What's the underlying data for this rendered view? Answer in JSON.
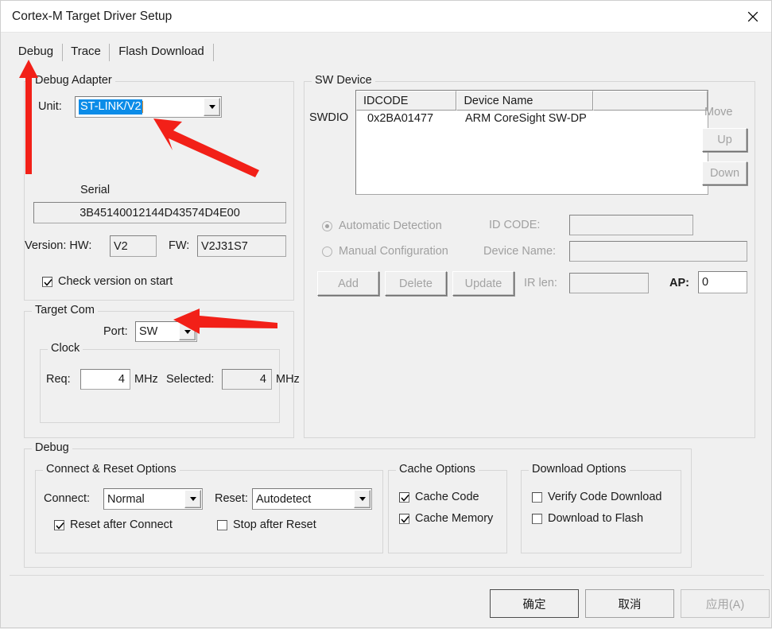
{
  "window": {
    "title": "Cortex-M Target Driver Setup",
    "close_icon": "close-x-icon"
  },
  "tabs": [
    {
      "label": "Debug",
      "selected": true
    },
    {
      "label": "Trace",
      "selected": false
    },
    {
      "label": "Flash Download",
      "selected": false
    }
  ],
  "debug_adapter": {
    "legend": "Debug Adapter",
    "unit_label": "Unit:",
    "unit_value": "ST-LINK/V2",
    "serial_label": "Serial",
    "serial_value": "3B45140012144D43574D4E00",
    "version_label": "Version: HW:",
    "hw_value": "V2",
    "fw_label": "FW:",
    "fw_value": "V2J31S7",
    "check_version_label": "Check version on start",
    "check_version_checked": true
  },
  "target_com": {
    "legend": "Target Com",
    "port_label": "Port:",
    "port_value": "SW",
    "clock_legend": "Clock",
    "req_label": "Req:",
    "req_value": "4",
    "req_unit": "MHz",
    "selected_label": "Selected:",
    "selected_value": "4",
    "selected_unit": "MHz"
  },
  "sw_device": {
    "legend": "SW Device",
    "bus_label": "SWDIO",
    "columns": [
      "IDCODE",
      "Device Name",
      ""
    ],
    "rows": [
      {
        "idcode": "0x2BA01477",
        "device_name": "ARM CoreSight SW-DP"
      }
    ],
    "move_label": "Move",
    "up_label": "Up",
    "down_label": "Down",
    "automatic_detection_label": "Automatic Detection",
    "automatic_detection_selected": true,
    "manual_configuration_label": "Manual Configuration",
    "manual_configuration_selected": false,
    "id_code_label": "ID CODE:",
    "id_code_value": "",
    "device_name_label": "Device Name:",
    "device_name_value": "",
    "ir_len_label": "IR len:",
    "ir_len_value": "",
    "ap_label": "AP:",
    "ap_value": "0",
    "add_label": "Add",
    "delete_label": "Delete",
    "update_label": "Update"
  },
  "debug_section": {
    "legend": "Debug",
    "connect_reset": {
      "legend": "Connect & Reset Options",
      "connect_label": "Connect:",
      "connect_value": "Normal",
      "reset_label": "Reset:",
      "reset_value": "Autodetect",
      "reset_after_connect_label": "Reset after Connect",
      "reset_after_connect_checked": true,
      "stop_after_reset_label": "Stop after Reset",
      "stop_after_reset_checked": false
    },
    "cache_options": {
      "legend": "Cache Options",
      "cache_code_label": "Cache Code",
      "cache_code_checked": true,
      "cache_memory_label": "Cache Memory",
      "cache_memory_checked": true
    },
    "download_options": {
      "legend": "Download Options",
      "verify_code_download_label": "Verify Code Download",
      "verify_code_download_checked": false,
      "download_to_flash_label": "Download to Flash",
      "download_to_flash_checked": false
    }
  },
  "footer": {
    "ok_label": "确定",
    "cancel_label": "取消",
    "apply_label": "应用(A)",
    "apply_enabled": false
  },
  "annotations": {
    "color": "#f22018",
    "arrows": [
      {
        "name": "arrow-to-debug-tab",
        "points_to": "Debug tab"
      },
      {
        "name": "arrow-to-unit-combo",
        "points_to": "Unit combo box"
      },
      {
        "name": "arrow-to-port-combo",
        "points_to": "Port combo box"
      }
    ]
  }
}
